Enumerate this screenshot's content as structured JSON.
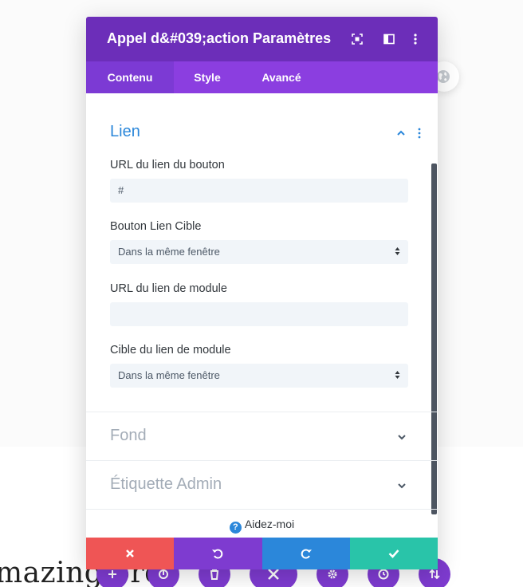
{
  "modal": {
    "title": "Appel d&#039;action Paramètres",
    "tabs": [
      {
        "label": "Contenu",
        "active": true
      },
      {
        "label": "Style",
        "active": false
      },
      {
        "label": "Avancé",
        "active": false
      }
    ]
  },
  "sections": {
    "lien": {
      "title": "Lien",
      "fields": {
        "button_url_label": "URL du lien du bouton",
        "button_url_value": "#",
        "button_target_label": "Bouton Lien Cible",
        "button_target_value": "Dans la même fenêtre",
        "module_url_label": "URL du lien de module",
        "module_url_value": "",
        "module_target_label": "Cible du lien de module",
        "module_target_value": "Dans la même fenêtre"
      }
    },
    "fond": {
      "title": "Fond"
    },
    "admin": {
      "title": "Étiquette Admin"
    }
  },
  "help": {
    "label": "Aidez-moi"
  },
  "footer": {
    "colors": {
      "cancel": "#ef5555",
      "undo": "#7e3bd0",
      "redo": "#2b87da",
      "save": "#29c4a9"
    }
  },
  "background": {
    "text": "mazing  orce"
  },
  "colors": {
    "header": "#6c2eb9",
    "tabs": "#8b3ee0",
    "accent": "#2b87da"
  }
}
